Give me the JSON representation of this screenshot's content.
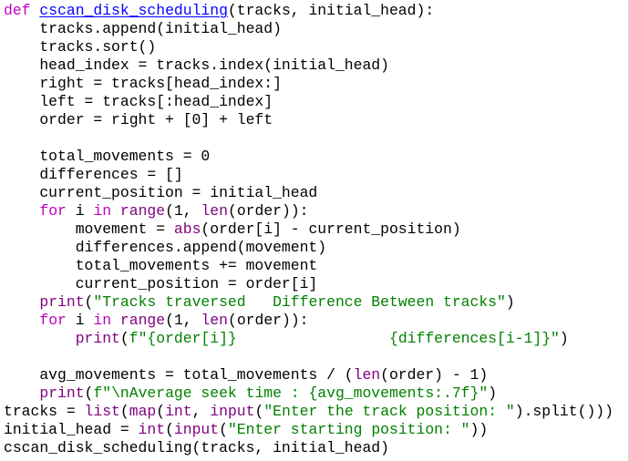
{
  "editor": {
    "language": "python",
    "colors": {
      "background": "#ffffff",
      "text": "#000000",
      "keyword": "#c000c0",
      "function_name": "#0000ff",
      "builtin": "#7f007f",
      "string": "#008000"
    },
    "lines": [
      [
        {
          "t": "def",
          "c": "kw"
        },
        {
          "t": " "
        },
        {
          "t": "cscan_disk_scheduling",
          "c": "fn"
        },
        {
          "t": "(tracks, initial_head):"
        }
      ],
      [
        {
          "t": "    tracks.append(initial_head)"
        }
      ],
      [
        {
          "t": "    tracks.sort()"
        }
      ],
      [
        {
          "t": "    head_index = tracks.index(initial_head)"
        }
      ],
      [
        {
          "t": "    right = tracks[head_index:]"
        }
      ],
      [
        {
          "t": "    left = tracks[:head_index]"
        }
      ],
      [
        {
          "t": "    order = right + [0] + left"
        }
      ],
      [
        {
          "t": ""
        }
      ],
      [
        {
          "t": "    total_movements = 0"
        }
      ],
      [
        {
          "t": "    differences = []"
        }
      ],
      [
        {
          "t": "    current_position = initial_head"
        }
      ],
      [
        {
          "t": "    "
        },
        {
          "t": "for",
          "c": "kw"
        },
        {
          "t": " i "
        },
        {
          "t": "in",
          "c": "kw"
        },
        {
          "t": " "
        },
        {
          "t": "range",
          "c": "bi"
        },
        {
          "t": "(1, "
        },
        {
          "t": "len",
          "c": "bi"
        },
        {
          "t": "(order)):"
        }
      ],
      [
        {
          "t": "        movement = "
        },
        {
          "t": "abs",
          "c": "bi"
        },
        {
          "t": "(order[i] - current_position)"
        }
      ],
      [
        {
          "t": "        differences.append(movement)"
        }
      ],
      [
        {
          "t": "        total_movements += movement"
        }
      ],
      [
        {
          "t": "        current_position = order[i]"
        }
      ],
      [
        {
          "t": "    "
        },
        {
          "t": "print",
          "c": "bi"
        },
        {
          "t": "("
        },
        {
          "t": "\"Tracks traversed   Difference Between tracks\"",
          "c": "st"
        },
        {
          "t": ")"
        }
      ],
      [
        {
          "t": "    "
        },
        {
          "t": "for",
          "c": "kw"
        },
        {
          "t": " i "
        },
        {
          "t": "in",
          "c": "kw"
        },
        {
          "t": " "
        },
        {
          "t": "range",
          "c": "bi"
        },
        {
          "t": "(1, "
        },
        {
          "t": "len",
          "c": "bi"
        },
        {
          "t": "(order)):"
        }
      ],
      [
        {
          "t": "        "
        },
        {
          "t": "print",
          "c": "bi"
        },
        {
          "t": "("
        },
        {
          "t": "f\"{order[i]}                 {differences[i-1]}\"",
          "c": "st"
        },
        {
          "t": ")"
        }
      ],
      [
        {
          "t": ""
        }
      ],
      [
        {
          "t": "    avg_movements = total_movements / ("
        },
        {
          "t": "len",
          "c": "bi"
        },
        {
          "t": "(order) - 1)"
        }
      ],
      [
        {
          "t": "    "
        },
        {
          "t": "print",
          "c": "bi"
        },
        {
          "t": "("
        },
        {
          "t": "f\"\\nAverage seek time : {avg_movements:.7f}\"",
          "c": "st"
        },
        {
          "t": ")"
        }
      ],
      [
        {
          "t": "tracks = "
        },
        {
          "t": "list",
          "c": "bi"
        },
        {
          "t": "("
        },
        {
          "t": "map",
          "c": "bi"
        },
        {
          "t": "("
        },
        {
          "t": "int",
          "c": "bi"
        },
        {
          "t": ", "
        },
        {
          "t": "input",
          "c": "bi"
        },
        {
          "t": "("
        },
        {
          "t": "\"Enter the track position: \"",
          "c": "st"
        },
        {
          "t": ").split()))"
        }
      ],
      [
        {
          "t": "initial_head = "
        },
        {
          "t": "int",
          "c": "bi"
        },
        {
          "t": "("
        },
        {
          "t": "input",
          "c": "bi"
        },
        {
          "t": "("
        },
        {
          "t": "\"Enter starting position: \"",
          "c": "st"
        },
        {
          "t": "))"
        }
      ],
      [
        {
          "t": "cscan_disk_scheduling(tracks, initial_head)"
        }
      ]
    ]
  }
}
